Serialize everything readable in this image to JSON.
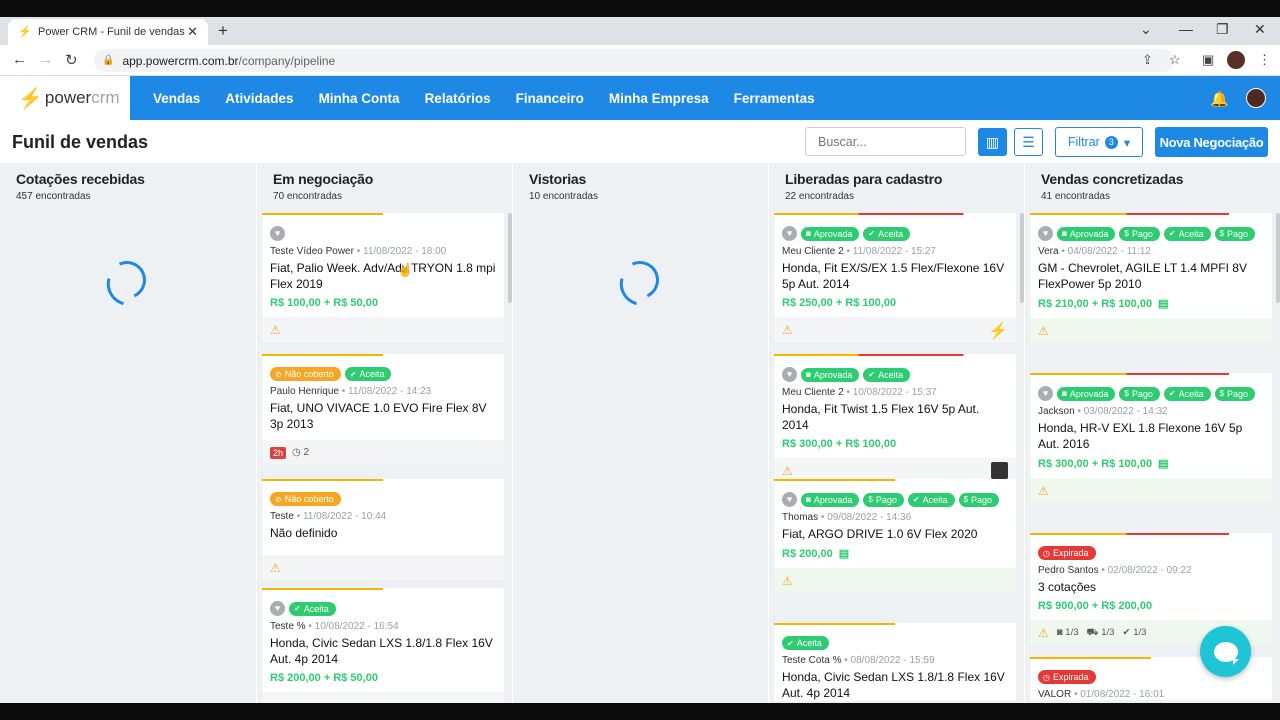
{
  "browser": {
    "tab_title": "Power CRM - Funil de vendas",
    "url_host": "app.powercrm.com.br",
    "url_path": "/company/pipeline"
  },
  "header": {
    "logo_a": "power",
    "logo_b": "crm",
    "nav": [
      "Vendas",
      "Atividades",
      "Minha Conta",
      "Relatórios",
      "Financeiro",
      "Minha Empresa",
      "Ferramentas"
    ]
  },
  "toolbar": {
    "title": "Funil de vendas",
    "search_placeholder": "Buscar...",
    "filter_label": "Filtrar",
    "filter_count": "3",
    "new_deal_label": "Nova Negociação"
  },
  "columns": [
    {
      "title": "Cotações recebidas",
      "count": "457 encontradas"
    },
    {
      "title": "Em negociação",
      "count": "70 encontradas"
    },
    {
      "title": "Vistorias",
      "count": "10 encontradas"
    },
    {
      "title": "Liberadas para cadastro",
      "count": "22 encontradas"
    },
    {
      "title": "Vendas concretizadas",
      "count": "41 encontradas"
    }
  ],
  "negociacao_cards": [
    {
      "name": "Teste Vídeo Power",
      "date": "11/08/2022 - 18:00",
      "vehicle": "Fiat, Palio Week. Adv/Adv TRYON 1.8 mpi Flex 2019",
      "price": "R$ 100,00 + R$ 50,00"
    },
    {
      "tag1": "Não coberto",
      "tag2": "Aceita",
      "name": "Paulo Henrique",
      "date": "11/08/2022 - 14:23",
      "vehicle": "Fiat, UNO VIVACE 1.0 EVO Fire Flex 8V 3p 2013",
      "badge": "2h",
      "clock": "2"
    },
    {
      "tag1": "Não coberto",
      "name": "Teste",
      "date": "11/08/2022 - 10:44",
      "vehicle": "Não definido"
    },
    {
      "tag1": "Aceita",
      "name": "Teste %",
      "date": "10/08/2022 - 16:54",
      "vehicle": "Honda, Civic Sedan LXS 1.8/1.8 Flex 16V Aut. 4p 2014",
      "price": "R$ 200,00 + R$ 50,00"
    }
  ],
  "liberadas_cards": [
    {
      "tag1": "Aprovada",
      "tag2": "Aceita",
      "name": "Meu Cliente 2",
      "date": "11/08/2022 - 15:27",
      "vehicle": "Honda, Fit EX/S/EX 1.5 Flex/Flexone 16V 5p Aut. 2014",
      "price": "R$ 250,00 + R$ 100,00"
    },
    {
      "tag1": "Aprovada",
      "tag2": "Aceita",
      "name": "Meu Cliente 2",
      "date": "10/08/2022 - 15:37",
      "vehicle": "Honda, Fit Twist 1.5 Flex 16V 5p Aut. 2014",
      "price": "R$ 300,00 + R$ 100,00"
    },
    {
      "tag1": "Aprovada",
      "tag2": "Pago",
      "tag3": "Aceita",
      "tag4": "Pago",
      "name": "Thomas",
      "date": "09/08/2022 - 14:36",
      "vehicle": "Fiat, ARGO DRIVE 1.0 6V Flex 2020",
      "price": "R$ 200,00"
    },
    {
      "tag1": "Aceita",
      "name": "Teste Cota %",
      "date": "08/08/2022 - 15:59",
      "vehicle": "Honda, Civic Sedan LXS 1.8/1.8 Flex 16V Aut. 4p 2014"
    }
  ],
  "vendas_cards": [
    {
      "tag1": "Aprovada",
      "tag2": "Pago",
      "tag3": "Aceita",
      "tag4": "Pago",
      "name": "Vera",
      "date": "04/08/2022 - 11:12",
      "vehicle": "GM - Chevrolet, AGILE LT 1.4 MPFI 8V FlexPower 5p 2010",
      "price": "R$ 210,00 + R$ 100,00"
    },
    {
      "tag1": "Aprovada",
      "tag2": "Pago",
      "tag3": "Aceita",
      "tag4": "Pago",
      "name": "Jackson",
      "date": "03/08/2022 - 14:32",
      "vehicle": "Honda, HR-V EXL 1.8 Flexone 16V 5p Aut. 2016",
      "price": "R$ 300,00 + R$ 100,00"
    },
    {
      "tag1": "Expirada",
      "name": "Pedro Santos",
      "date": "02/08/2022 - 09:22",
      "vehicle": "3 cotações",
      "price": "R$ 900,00 + R$ 200,00",
      "m1": "1/3",
      "m2": "1/3",
      "m3": "1/3"
    },
    {
      "tag1": "Expirada",
      "name": "VALOR",
      "date": "01/08/2022 - 16:01"
    }
  ]
}
